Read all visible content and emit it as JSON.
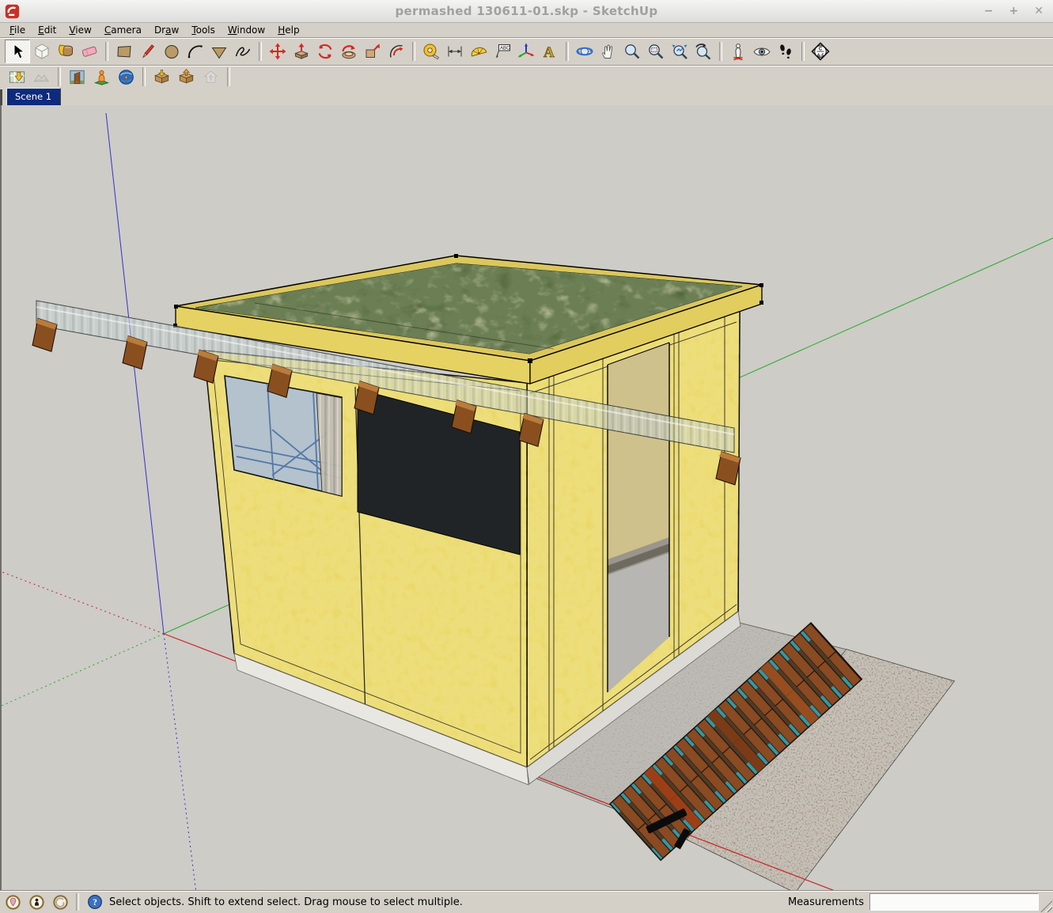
{
  "window": {
    "title": "permashed 130611-01.skp - SketchUp",
    "controls": {
      "minimize": "−",
      "maximize": "+",
      "close": "✕"
    }
  },
  "menu": {
    "items": [
      "File",
      "Edit",
      "View",
      "Camera",
      "Draw",
      "Tools",
      "Window",
      "Help"
    ],
    "mnemonics": [
      0,
      0,
      0,
      0,
      2,
      0,
      0,
      0
    ]
  },
  "toolbar_main": {
    "items": [
      {
        "tool": "select",
        "icon": "select-icon",
        "active": true
      },
      {
        "tool": "make-component",
        "icon": "make-component-icon"
      },
      {
        "tool": "paint-bucket",
        "icon": "paint-bucket-icon"
      },
      {
        "tool": "eraser",
        "icon": "eraser-icon"
      },
      {
        "separator": true
      },
      {
        "tool": "rectangle",
        "icon": "rectangle-icon"
      },
      {
        "tool": "line",
        "icon": "line-icon"
      },
      {
        "tool": "circle",
        "icon": "circle-icon"
      },
      {
        "tool": "arc",
        "icon": "arc-icon"
      },
      {
        "tool": "polygon",
        "icon": "polygon-icon"
      },
      {
        "tool": "freehand",
        "icon": "freehand-icon"
      },
      {
        "separator": true
      },
      {
        "tool": "move",
        "icon": "move-icon"
      },
      {
        "tool": "push-pull",
        "icon": "push-pull-icon"
      },
      {
        "tool": "rotate",
        "icon": "rotate-icon"
      },
      {
        "tool": "follow-me",
        "icon": "follow-me-icon"
      },
      {
        "tool": "scale",
        "icon": "scale-icon"
      },
      {
        "tool": "offset",
        "icon": "offset-icon"
      },
      {
        "separator": true
      },
      {
        "tool": "tape-measure",
        "icon": "tape-measure-icon"
      },
      {
        "tool": "dimension",
        "icon": "dimension-icon"
      },
      {
        "tool": "protractor",
        "icon": "protractor-icon"
      },
      {
        "tool": "text",
        "icon": "text-icon"
      },
      {
        "tool": "axes",
        "icon": "axes-icon"
      },
      {
        "tool": "3d-text",
        "icon": "3d-text-icon"
      },
      {
        "separator": true
      },
      {
        "tool": "orbit",
        "icon": "orbit-icon"
      },
      {
        "tool": "pan",
        "icon": "pan-icon"
      },
      {
        "tool": "zoom",
        "icon": "zoom-icon"
      },
      {
        "tool": "zoom-window",
        "icon": "zoom-window-icon"
      },
      {
        "tool": "zoom-extents",
        "icon": "zoom-extents-icon"
      },
      {
        "tool": "zoom-previous",
        "icon": "zoom-previous-icon"
      },
      {
        "separator": true
      },
      {
        "tool": "position-camera",
        "icon": "position-camera-icon"
      },
      {
        "tool": "look-around",
        "icon": "look-around-icon"
      },
      {
        "tool": "walk",
        "icon": "walk-icon"
      },
      {
        "separator": true
      },
      {
        "tool": "section-plane",
        "icon": "section-plane-icon"
      }
    ]
  },
  "toolbar_google": {
    "items": [
      {
        "tool": "add-location",
        "icon": "add-location-icon"
      },
      {
        "tool": "toggle-terrain",
        "icon": "toggle-terrain-icon",
        "disabled": true
      },
      {
        "separator": true
      },
      {
        "tool": "photo-textures",
        "icon": "photo-textures-icon"
      },
      {
        "tool": "preview-google-earth",
        "icon": "preview-google-earth-icon"
      },
      {
        "tool": "google-earth",
        "icon": "google-earth-icon"
      },
      {
        "separator": true
      },
      {
        "tool": "get-models",
        "icon": "get-models-icon"
      },
      {
        "tool": "share-model",
        "icon": "share-model-icon"
      },
      {
        "tool": "share-component",
        "icon": "share-component-icon",
        "disabled": true
      },
      {
        "separator": true
      }
    ]
  },
  "scene_tabs": [
    {
      "label": "Scene 1",
      "active": true
    }
  ],
  "status_bar": {
    "icons": [
      {
        "icon": "geolocation-icon"
      },
      {
        "icon": "claim-credit-icon"
      },
      {
        "icon": "google-signin-icon"
      }
    ],
    "help_icon": "help-icon",
    "message": "Select objects. Shift to extend select. Drag mouse to select multiple.",
    "measurements_label": "Measurements",
    "measurements_value": ""
  },
  "colors": {
    "chrome": "#d4d0c8",
    "titlebar": "#e9e9e8",
    "title_text": "#a0a09e",
    "viewport_bg": "#cdccc7",
    "scene_tab_bg": "#0e2a7c",
    "scene_tab_text": "#ffffff",
    "wall": "#e9d765",
    "fascia": "#e6d262",
    "roof_grass": "#46572d",
    "glass": "#b3c2cd",
    "frame_blue": "#5578a8",
    "panel_black": "#212426",
    "wood": "#8a4f1f",
    "pad": "#a9a7a3",
    "gravel": "#8f867b",
    "foundation": "#e9e7e1",
    "walk_plank": "#8a4a22",
    "walk_teal": "#2f9aa8",
    "axis_red": "#cc2222",
    "axis_green": "#22aa22",
    "axis_blue": "#3333cc"
  }
}
